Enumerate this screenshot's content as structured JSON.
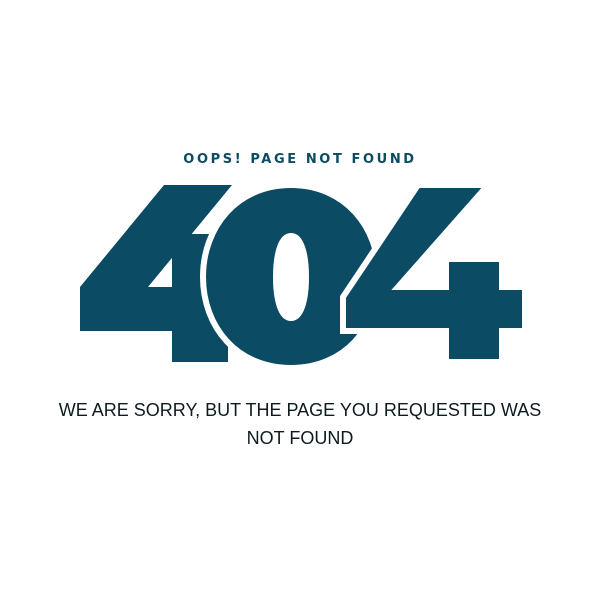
{
  "error_page": {
    "kicker": "OOPS! PAGE NOT FOUND",
    "code": "404",
    "message": "WE ARE SORRY, BUT THE PAGE YOU REQUESTED WAS NOT FOUND",
    "accent_color": "#0b4b63",
    "text_color": "#0d1b21"
  }
}
